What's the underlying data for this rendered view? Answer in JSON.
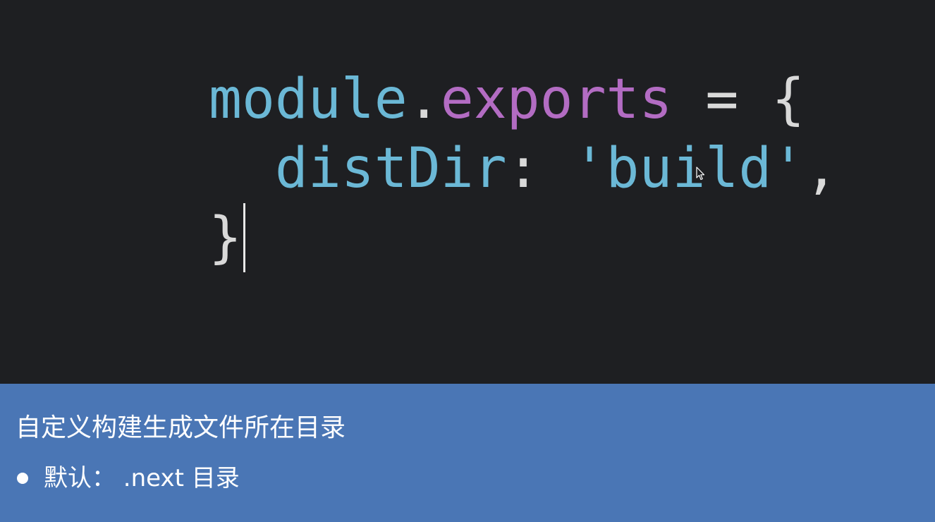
{
  "code": {
    "line1": {
      "object": "module",
      "dot": ".",
      "property": "exports",
      "rest": " = {"
    },
    "line2": {
      "indent": "  ",
      "key": "distDir",
      "colon": ": ",
      "string": "'build'",
      "comma": ","
    },
    "line3": {
      "brace": "}"
    }
  },
  "caption": {
    "title": "自定义构建生成文件所在目录",
    "bullet": "默认：  .next 目录"
  },
  "colors": {
    "editor_bg": "#1e1f22",
    "identifier": "#6bb8d6",
    "property": "#b36cc3",
    "punctuation": "#d9d9d9",
    "caption_bg": "#4a76b5"
  },
  "icons": {
    "mouse": "mouse-pointer-icon",
    "bullet": "bullet-dot-icon"
  }
}
